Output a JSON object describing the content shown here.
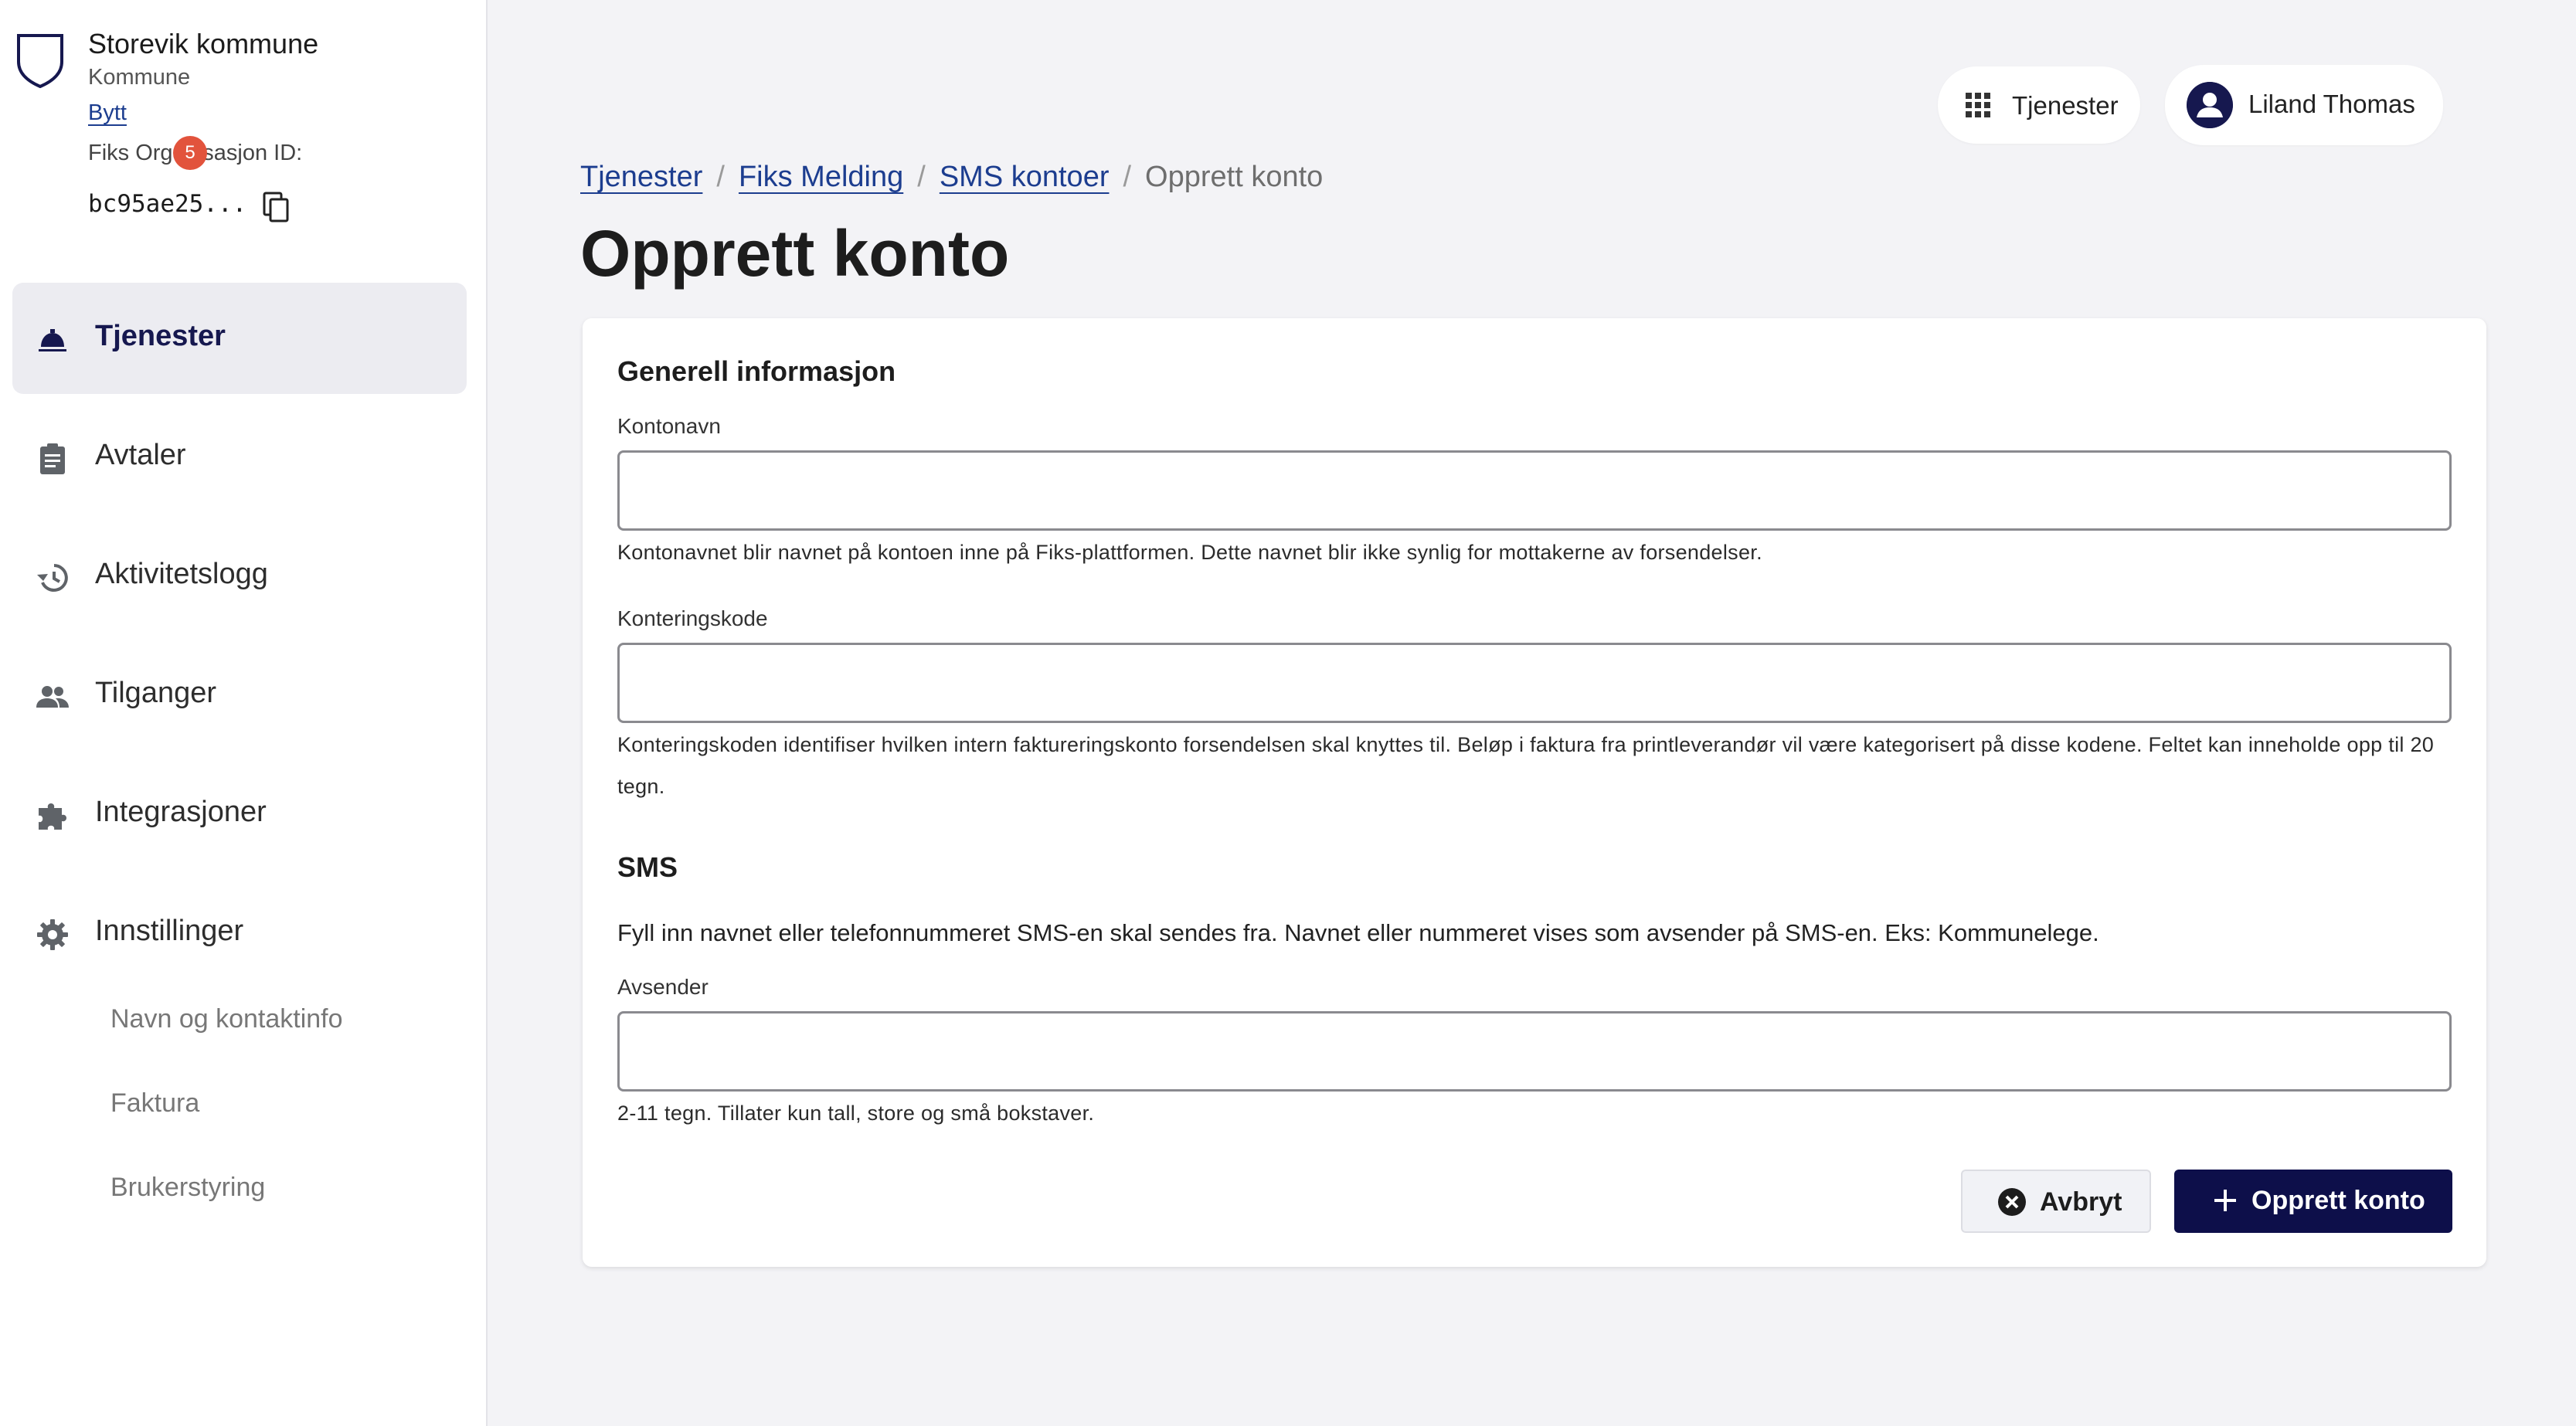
{
  "org": {
    "name": "Storevik kommune",
    "type": "Kommune",
    "switch_label": "Bytt",
    "id_label": "Fiks Organisasjon ID:",
    "id_value": "bc95ae25..."
  },
  "nav": {
    "items": [
      {
        "label": "Tjenester",
        "icon": "service-bell-icon",
        "active": true
      },
      {
        "label": "Avtaler",
        "icon": "clipboard-icon",
        "badge": "5"
      },
      {
        "label": "Aktivitetslogg",
        "icon": "history-icon"
      },
      {
        "label": "Tilganger",
        "icon": "people-icon"
      },
      {
        "label": "Integrasjoner",
        "icon": "puzzle-icon"
      },
      {
        "label": "Innstillinger",
        "icon": "gear-icon"
      }
    ],
    "sub_items": [
      "Navn og kontaktinfo",
      "Faktura",
      "Brukerstyring"
    ]
  },
  "header": {
    "services_label": "Tjenester",
    "user_name": "Liland Thomas"
  },
  "breadcrumb": {
    "items": [
      "Tjenester",
      "Fiks Melding",
      "SMS kontoer"
    ],
    "current": "Opprett konto"
  },
  "page": {
    "title": "Opprett konto"
  },
  "form": {
    "general_title": "Generell informasjon",
    "account_name": {
      "label": "Kontonavn",
      "value": "",
      "help": "Kontonavnet blir navnet på kontoen inne på Fiks-plattformen. Dette navnet blir ikke synlig for mottakerne av forsendelser."
    },
    "accounting_code": {
      "label": "Konteringskode",
      "value": "",
      "help": "Konteringskoden identifiser hvilken intern faktureringskonto forsendelsen skal knyttes til. Beløp i faktura fra printleverandør vil være kategorisert på disse kodene. Feltet kan inneholde opp til 20 tegn."
    },
    "sms_title": "SMS",
    "sms_description": "Fyll inn navnet eller telefonnummeret SMS-en skal sendes fra. Navnet eller nummeret vises som avsender på SMS-en. Eks: Kommunelege.",
    "sender": {
      "label": "Avsender",
      "value": "",
      "help": "2-11 tegn. Tillater kun tall, store og små bokstaver."
    },
    "cancel_label": "Avbryt",
    "submit_label": "Opprett konto"
  },
  "colors": {
    "primary": "#0d0f4a",
    "link": "#1c3d8f",
    "badge": "#e2533c",
    "background": "#f3f3f6"
  }
}
